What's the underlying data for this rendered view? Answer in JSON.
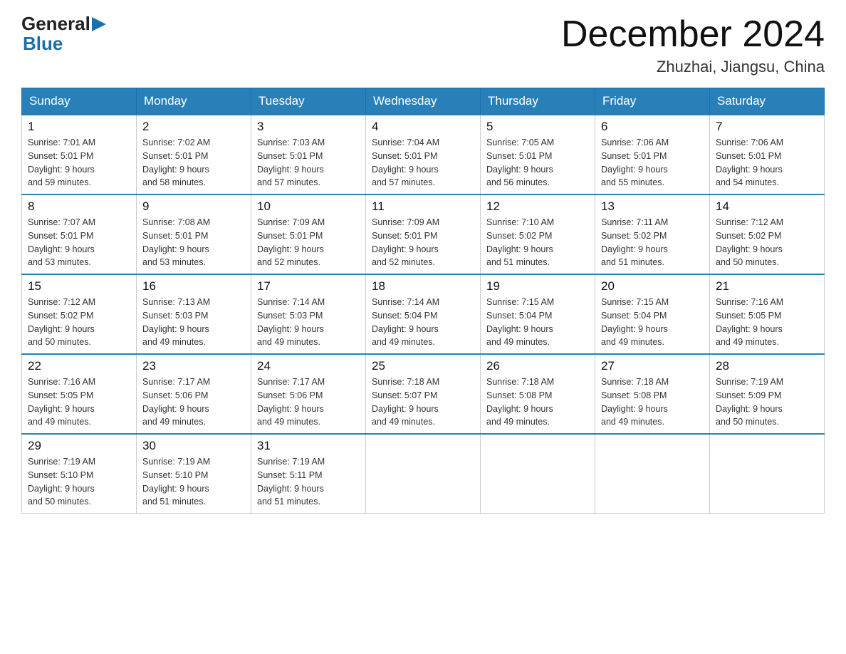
{
  "header": {
    "logo_general": "General",
    "logo_blue": "Blue",
    "month_title": "December 2024",
    "location": "Zhuzhai, Jiangsu, China"
  },
  "days_of_week": [
    "Sunday",
    "Monday",
    "Tuesday",
    "Wednesday",
    "Thursday",
    "Friday",
    "Saturday"
  ],
  "weeks": [
    [
      {
        "day": "1",
        "sunrise": "7:01 AM",
        "sunset": "5:01 PM",
        "daylight": "9 hours and 59 minutes."
      },
      {
        "day": "2",
        "sunrise": "7:02 AM",
        "sunset": "5:01 PM",
        "daylight": "9 hours and 58 minutes."
      },
      {
        "day": "3",
        "sunrise": "7:03 AM",
        "sunset": "5:01 PM",
        "daylight": "9 hours and 57 minutes."
      },
      {
        "day": "4",
        "sunrise": "7:04 AM",
        "sunset": "5:01 PM",
        "daylight": "9 hours and 57 minutes."
      },
      {
        "day": "5",
        "sunrise": "7:05 AM",
        "sunset": "5:01 PM",
        "daylight": "9 hours and 56 minutes."
      },
      {
        "day": "6",
        "sunrise": "7:06 AM",
        "sunset": "5:01 PM",
        "daylight": "9 hours and 55 minutes."
      },
      {
        "day": "7",
        "sunrise": "7:06 AM",
        "sunset": "5:01 PM",
        "daylight": "9 hours and 54 minutes."
      }
    ],
    [
      {
        "day": "8",
        "sunrise": "7:07 AM",
        "sunset": "5:01 PM",
        "daylight": "9 hours and 53 minutes."
      },
      {
        "day": "9",
        "sunrise": "7:08 AM",
        "sunset": "5:01 PM",
        "daylight": "9 hours and 53 minutes."
      },
      {
        "day": "10",
        "sunrise": "7:09 AM",
        "sunset": "5:01 PM",
        "daylight": "9 hours and 52 minutes."
      },
      {
        "day": "11",
        "sunrise": "7:09 AM",
        "sunset": "5:01 PM",
        "daylight": "9 hours and 52 minutes."
      },
      {
        "day": "12",
        "sunrise": "7:10 AM",
        "sunset": "5:02 PM",
        "daylight": "9 hours and 51 minutes."
      },
      {
        "day": "13",
        "sunrise": "7:11 AM",
        "sunset": "5:02 PM",
        "daylight": "9 hours and 51 minutes."
      },
      {
        "day": "14",
        "sunrise": "7:12 AM",
        "sunset": "5:02 PM",
        "daylight": "9 hours and 50 minutes."
      }
    ],
    [
      {
        "day": "15",
        "sunrise": "7:12 AM",
        "sunset": "5:02 PM",
        "daylight": "9 hours and 50 minutes."
      },
      {
        "day": "16",
        "sunrise": "7:13 AM",
        "sunset": "5:03 PM",
        "daylight": "9 hours and 49 minutes."
      },
      {
        "day": "17",
        "sunrise": "7:14 AM",
        "sunset": "5:03 PM",
        "daylight": "9 hours and 49 minutes."
      },
      {
        "day": "18",
        "sunrise": "7:14 AM",
        "sunset": "5:04 PM",
        "daylight": "9 hours and 49 minutes."
      },
      {
        "day": "19",
        "sunrise": "7:15 AM",
        "sunset": "5:04 PM",
        "daylight": "9 hours and 49 minutes."
      },
      {
        "day": "20",
        "sunrise": "7:15 AM",
        "sunset": "5:04 PM",
        "daylight": "9 hours and 49 minutes."
      },
      {
        "day": "21",
        "sunrise": "7:16 AM",
        "sunset": "5:05 PM",
        "daylight": "9 hours and 49 minutes."
      }
    ],
    [
      {
        "day": "22",
        "sunrise": "7:16 AM",
        "sunset": "5:05 PM",
        "daylight": "9 hours and 49 minutes."
      },
      {
        "day": "23",
        "sunrise": "7:17 AM",
        "sunset": "5:06 PM",
        "daylight": "9 hours and 49 minutes."
      },
      {
        "day": "24",
        "sunrise": "7:17 AM",
        "sunset": "5:06 PM",
        "daylight": "9 hours and 49 minutes."
      },
      {
        "day": "25",
        "sunrise": "7:18 AM",
        "sunset": "5:07 PM",
        "daylight": "9 hours and 49 minutes."
      },
      {
        "day": "26",
        "sunrise": "7:18 AM",
        "sunset": "5:08 PM",
        "daylight": "9 hours and 49 minutes."
      },
      {
        "day": "27",
        "sunrise": "7:18 AM",
        "sunset": "5:08 PM",
        "daylight": "9 hours and 49 minutes."
      },
      {
        "day": "28",
        "sunrise": "7:19 AM",
        "sunset": "5:09 PM",
        "daylight": "9 hours and 50 minutes."
      }
    ],
    [
      {
        "day": "29",
        "sunrise": "7:19 AM",
        "sunset": "5:10 PM",
        "daylight": "9 hours and 50 minutes."
      },
      {
        "day": "30",
        "sunrise": "7:19 AM",
        "sunset": "5:10 PM",
        "daylight": "9 hours and 51 minutes."
      },
      {
        "day": "31",
        "sunrise": "7:19 AM",
        "sunset": "5:11 PM",
        "daylight": "9 hours and 51 minutes."
      },
      null,
      null,
      null,
      null
    ]
  ],
  "labels": {
    "sunrise": "Sunrise:",
    "sunset": "Sunset:",
    "daylight": "Daylight:"
  }
}
